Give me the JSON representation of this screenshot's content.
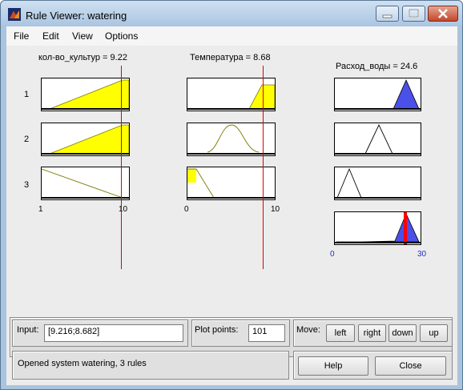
{
  "window": {
    "title": "Rule Viewer: watering"
  },
  "menu": [
    "File",
    "Edit",
    "View",
    "Options"
  ],
  "inputs": [
    {
      "title": "кол-во_культур = 9.22",
      "tick_min": "1",
      "tick_max": "10"
    },
    {
      "title": "Температура = 8.68",
      "tick_min": "0",
      "tick_max": "10"
    }
  ],
  "output": {
    "title": "Расход_воды = 24.6",
    "tick_min": "0",
    "tick_max": "30"
  },
  "rule_numbers": [
    "1",
    "2",
    "3"
  ],
  "controls": {
    "input_label": "Input:",
    "input_value": "[9.216;8.682]",
    "plot_points_label": "Plot points:",
    "plot_points_value": "101",
    "move_label": "Move:",
    "left": "left",
    "right": "right",
    "down": "down",
    "up": "up",
    "help": "Help",
    "close": "Close"
  },
  "status": "Opened system watering, 3 rules",
  "colors": {
    "input_fill": "#ffff00",
    "output_fill": "#4a50e8",
    "index_line": "#e00000",
    "aggregate_bar": "#ff0000"
  }
}
